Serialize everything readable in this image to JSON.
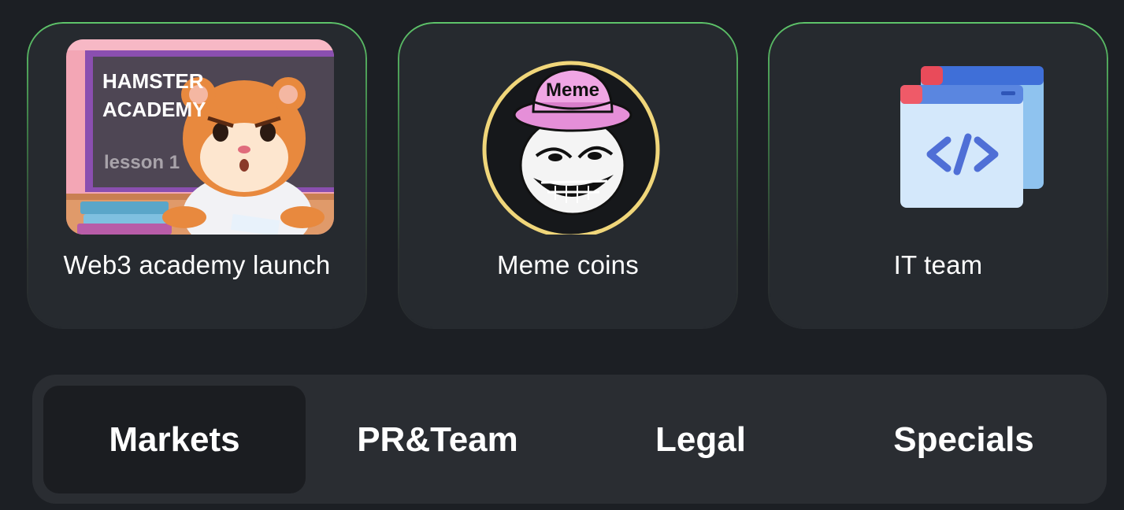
{
  "cards": [
    {
      "label": "Web3 academy launch",
      "image": "hamster-academy-image",
      "image_text": [
        "HAMSTER",
        "ACADEMY",
        "lesson 1"
      ]
    },
    {
      "label": "Meme coins",
      "image": "troll-face-meme-image",
      "image_text": [
        "Meme"
      ]
    },
    {
      "label": "IT team",
      "image": "code-window-icon"
    }
  ],
  "tabs": [
    {
      "label": "Markets",
      "active": true
    },
    {
      "label": "PR&Team",
      "active": false
    },
    {
      "label": "Legal",
      "active": false
    },
    {
      "label": "Specials",
      "active": false
    }
  ],
  "colors": {
    "background": "#1c1f24",
    "card": "#262a2f",
    "card_border_accent": "#5ec46a",
    "tab_bar": "#2a2d32",
    "tab_active": "#1b1d21"
  }
}
